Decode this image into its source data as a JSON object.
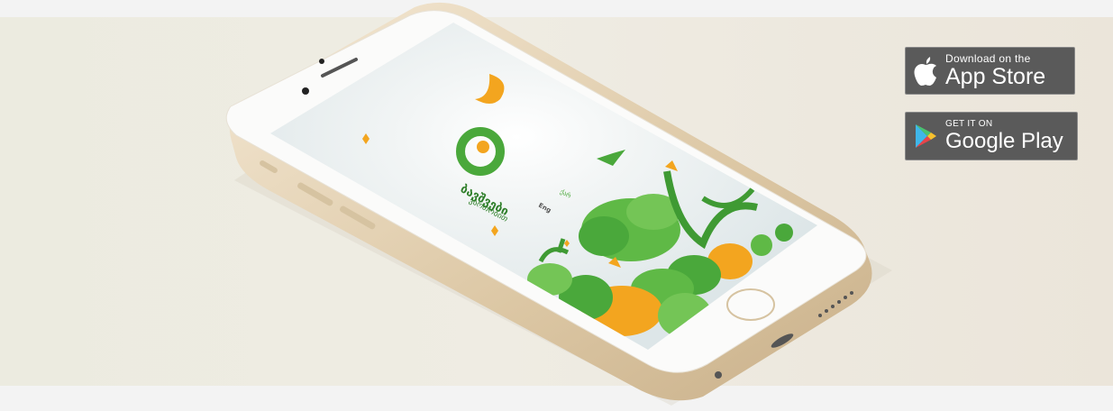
{
  "app": {
    "logo_title": "ბავშვები",
    "logo_subtitle": "ვართობით",
    "lang_en": "Eng",
    "lang_ka": "ქარ"
  },
  "badges": {
    "appstore": {
      "small": "Download on the",
      "big": "App Store",
      "icon": "apple-icon"
    },
    "googleplay": {
      "small": "GET IT ON",
      "big": "Google Play",
      "icon": "google-play-icon"
    }
  },
  "colors": {
    "accent_green": "#4aa83b",
    "accent_orange": "#f3a51f",
    "screen_bg": "#e8eef0",
    "phone_gold": "#e6d6bc"
  }
}
